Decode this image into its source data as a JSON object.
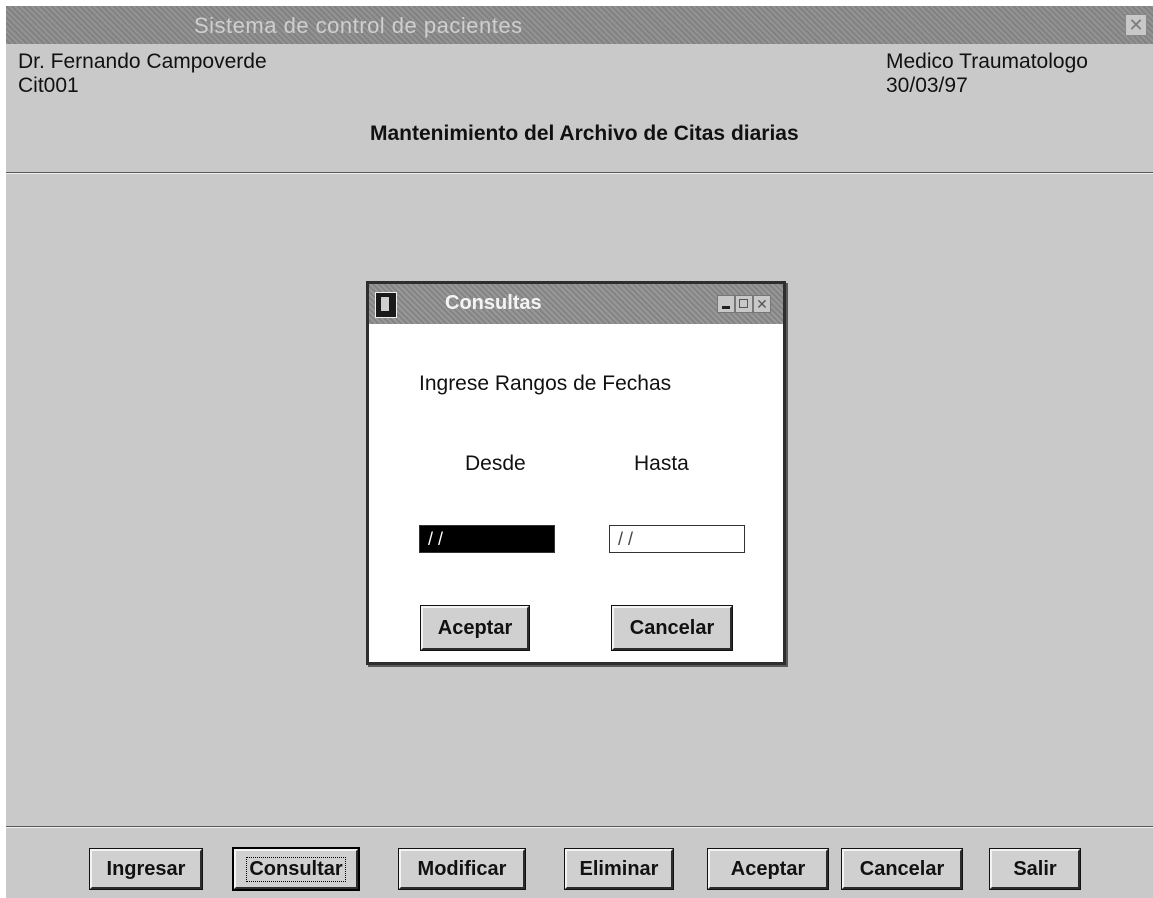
{
  "window": {
    "title": "Sistema de control de pacientes",
    "close_glyph": "✕"
  },
  "header": {
    "doctor": "Dr. Fernando Campoverde",
    "code": "Cit001",
    "specialty": "Medico Traumatologo",
    "date": "30/03/97",
    "form_title": "Mantenimiento del Archivo de Citas diarias"
  },
  "dialog": {
    "title": "Consultas",
    "prompt": "Ingrese Rangos de Fechas",
    "from_label": "Desde",
    "to_label": "Hasta",
    "from_value": "/ /",
    "to_value": "/ /",
    "accept_label": "Aceptar",
    "cancel_label": "Cancelar"
  },
  "toolbar": {
    "ingresar": "Ingresar",
    "consultar": "Consultar",
    "modificar": "Modificar",
    "eliminar": "Eliminar",
    "aceptar": "Aceptar",
    "cancelar": "Cancelar",
    "salir": "Salir"
  }
}
